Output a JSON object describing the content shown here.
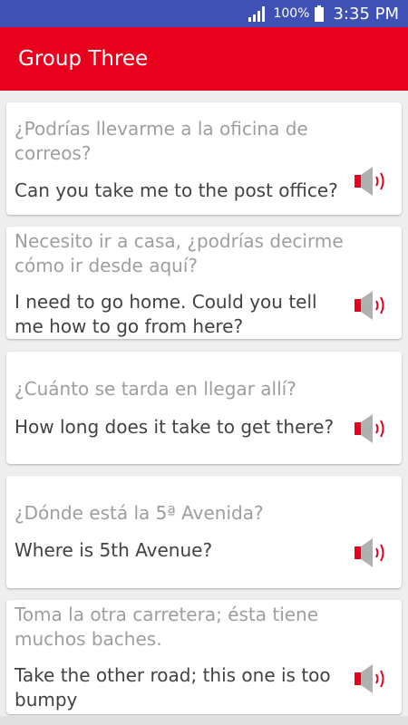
{
  "status_bar": {
    "battery": "100%",
    "time": "3:35 PM"
  },
  "app_bar": {
    "title": "Group Three"
  },
  "cards": [
    {
      "spanish": "¿Podrías llevarme a la oficina de correos?",
      "english": "Can you take me to the post office?"
    },
    {
      "spanish": "Necesito ir a casa, ¿podrías decirme cómo ir desde aquí?",
      "english": "I need to go home. Could you tell me how to go from here?"
    },
    {
      "spanish": "¿Cuánto se tarda en llegar allí?",
      "english": "How long does it take to get there?"
    },
    {
      "spanish": "¿Dónde está la 5ª Avenida?",
      "english": "Where is 5th Avenue?"
    },
    {
      "spanish": "Toma la otra carretera; ésta tiene muchos baches.",
      "english": "Take the other road; this one is too bumpy"
    }
  ],
  "colors": {
    "status_bar": "#3f51b5",
    "app_bar": "#e8001c",
    "spanish_text": "#9e9e9e",
    "english_text": "#424242",
    "speaker_waves": "#e8001c"
  }
}
